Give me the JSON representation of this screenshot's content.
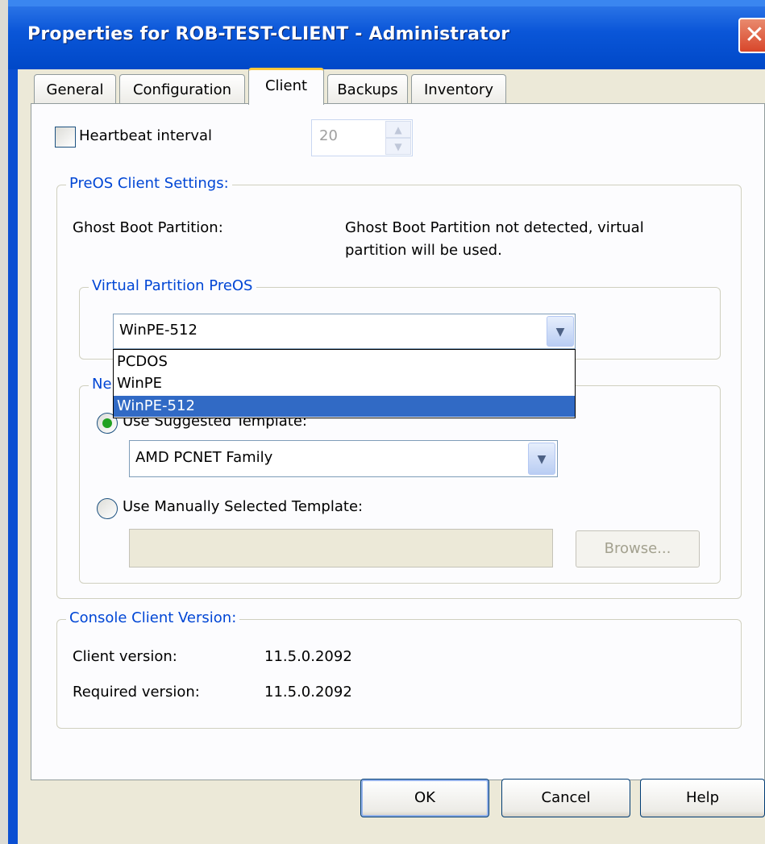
{
  "window": {
    "title": "Properties for ROB-TEST-CLIENT - Administrator",
    "close_symbol": "✕"
  },
  "tabs": [
    {
      "label": "General",
      "active": false
    },
    {
      "label": "Configuration",
      "active": false
    },
    {
      "label": "Client",
      "active": true
    },
    {
      "label": "Backups",
      "active": false
    },
    {
      "label": "Inventory",
      "active": false
    }
  ],
  "heartbeat": {
    "label": "Heartbeat interval",
    "checked": false,
    "value": "20",
    "up_symbol": "▲",
    "down_symbol": "▼"
  },
  "preos": {
    "legend": "PreOS Client Settings:",
    "ghost_boot_label": "Ghost Boot Partition:",
    "ghost_boot_value_line1": "Ghost Boot Partition not detected, virtual",
    "ghost_boot_value_line2": "partition will be used.",
    "virtual_partition": {
      "legend": "Virtual Partition PreOS",
      "selected": "WinPE-512",
      "options": [
        "PCDOS",
        "WinPE",
        "WinPE-512"
      ],
      "highlighted_index": 2
    },
    "network": {
      "legend_partial": "Ne",
      "suggested_label": "Use Suggested Template:",
      "suggested_selected": true,
      "suggested_value": "AMD PCNET Family",
      "manual_label": "Use Manually Selected Template:",
      "manual_value": "",
      "browse_label": "Browse..."
    }
  },
  "console_version": {
    "legend": "Console Client Version:",
    "client_label": "Client version:",
    "client_value": "11.5.0.2092",
    "required_label": "Required version:",
    "required_value": "11.5.0.2092"
  },
  "buttons": {
    "ok": "OK",
    "cancel": "Cancel",
    "help": "Help"
  },
  "icons": {
    "combo_arrow": "chevron-down-icon",
    "close": "close-icon"
  },
  "colors": {
    "titlebar": "#0a56d8",
    "legend_text": "#0046d5",
    "selection": "#316ac5",
    "active_tab_accent": "#ffc83c"
  }
}
